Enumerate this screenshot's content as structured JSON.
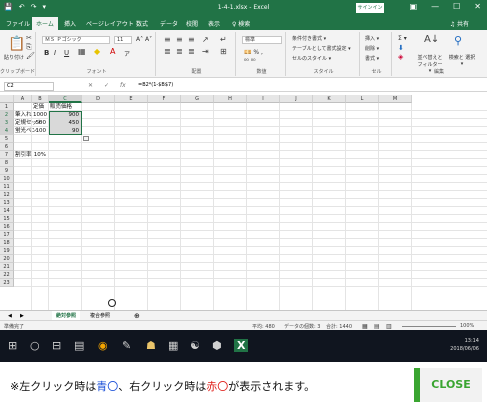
{
  "title_bar": {
    "quick_access": [
      "💾",
      "↶",
      "↷",
      "▾"
    ],
    "title": "1-4-1.xlsx - Excel",
    "signin_label": "サインイン",
    "window_buttons": [
      "▣",
      "—",
      "☐",
      "✕"
    ]
  },
  "menu": {
    "tabs": [
      "ファイル",
      "ホーム",
      "挿入",
      "ページレイアウト",
      "数式",
      "データ",
      "校閲",
      "表示",
      "♀ 検索"
    ],
    "active_tab": "ホーム",
    "share_label": "♫ 共有"
  },
  "ribbon": {
    "clipboard": {
      "paste_label": "貼り付け",
      "group_label": "クリップボード"
    },
    "font": {
      "name": "ＭＳ Ｐゴシック",
      "size": "11",
      "group_label": "フォント",
      "buttons": [
        "B",
        "I",
        "U"
      ]
    },
    "alignment": {
      "group_label": "配置"
    },
    "number": {
      "format": "標準",
      "group_label": "数値"
    },
    "styles": {
      "items": [
        "条件付き書式 ▾",
        "テーブルとして書式設定 ▾",
        "セルのスタイル ▾"
      ],
      "group_label": "スタイル"
    },
    "cells": {
      "items": [
        "挿入 ▾",
        "削除 ▾",
        "書式 ▾"
      ],
      "group_label": "セル"
    },
    "editing": {
      "items": [
        "Σ ▾",
        "並べ替えと フィルター ▾",
        "検索と 選択 ▾"
      ],
      "group_label": "編集"
    }
  },
  "formula_bar": {
    "name_box": "C2",
    "cancel": "✕",
    "enter": "✓",
    "fx": "fx",
    "formula": "=B2*(1-$B$7)"
  },
  "grid": {
    "columns": [
      "A",
      "B",
      "C",
      "D",
      "E",
      "F",
      "G",
      "H",
      "I",
      "J",
      "K",
      "L",
      "M"
    ],
    "rows": [
      "1",
      "2",
      "3",
      "4",
      "5",
      "6",
      "7",
      "8",
      "9",
      "10",
      "11",
      "12",
      "13",
      "14",
      "15",
      "16",
      "17",
      "18",
      "19",
      "20",
      "21",
      "22",
      "23"
    ],
    "cells": {
      "B1": "定価",
      "C1": "販売価格",
      "A2": "筆入れ",
      "B2": "1000",
      "C2": "900",
      "A3": "定規セット",
      "B3": "500",
      "C3": "450",
      "A4": "蛍光ペン",
      "B4": "100",
      "C4": "90",
      "A7": "割引率",
      "B7": "10%"
    },
    "selected_column": "C",
    "selected_rows": [
      "2",
      "3",
      "4"
    ]
  },
  "sheet_tabs": {
    "nav": [
      "◀",
      "▶"
    ],
    "tabs": [
      "絶対参照",
      "複合参照"
    ],
    "active": "絶対参照",
    "add": "⊕"
  },
  "status_bar": {
    "mode": "準備完了",
    "average": "平均: 480",
    "count": "データの個数: 3",
    "sum": "合計: 1440",
    "zoom": "100%"
  },
  "taskbar": {
    "icons": [
      "⊞",
      "○",
      "⊟",
      "▤",
      "◉",
      "✎",
      "☗",
      "▦",
      "☯",
      "⬢",
      "X"
    ],
    "time": "13:14",
    "date": "2018/06/06"
  },
  "footer": {
    "note_prefix": "※左クリック時は",
    "blue_word": "青",
    "circle": "〇",
    "note_middle": "、右クリック時は",
    "red_word": "赤",
    "note_suffix": "が表示されます。",
    "close_label": "CLOSE"
  }
}
